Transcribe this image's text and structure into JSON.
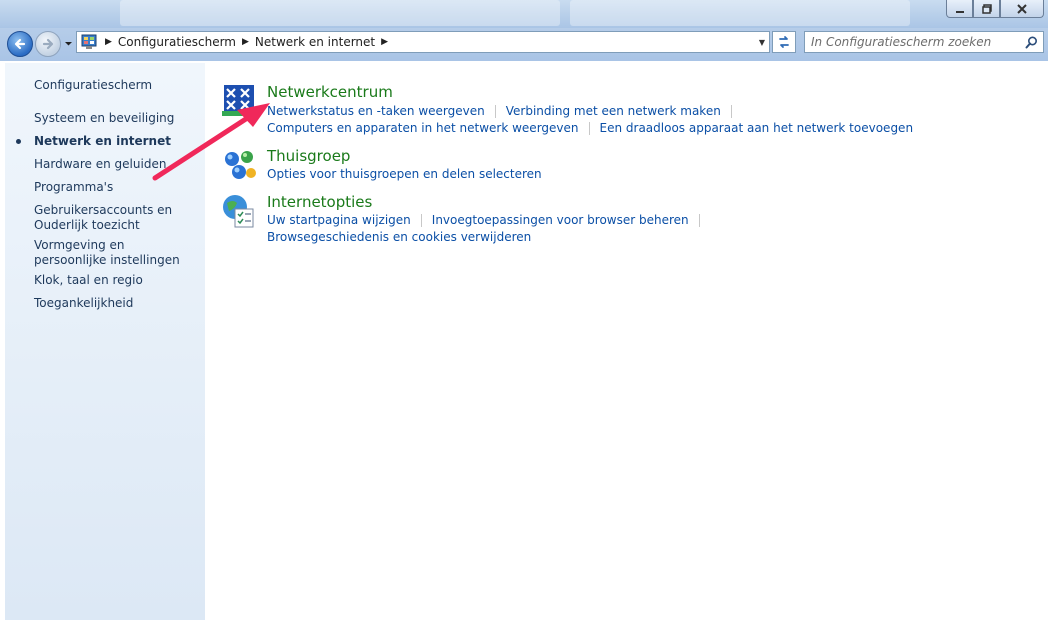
{
  "titlebar": {
    "minimize_icon": "minimize-icon",
    "maximize_icon": "maximize-icon",
    "close_icon": "close-icon"
  },
  "navbar": {
    "back_icon": "back-arrow-icon",
    "forward_icon": "forward-arrow-icon",
    "breadcrumbs": [
      "Configuratiescherm",
      "Netwerk en internet"
    ],
    "search_placeholder": "In Configuratiescherm zoeken"
  },
  "sidebar": {
    "items": [
      {
        "label": "Configuratiescherm"
      },
      {
        "label": "Systeem en beveiliging"
      },
      {
        "label": "Netwerk en internet",
        "active": true
      },
      {
        "label": "Hardware en geluiden"
      },
      {
        "label": "Programma's"
      },
      {
        "label": "Gebruikersaccounts en Ouderlijk toezicht"
      },
      {
        "label": "Vormgeving en persoonlijke instellingen"
      },
      {
        "label": "Klok, taal en regio"
      },
      {
        "label": "Toegankelijkheid"
      }
    ]
  },
  "main": {
    "categories": [
      {
        "title": "Netwerkcentrum",
        "icon": "network-center-icon",
        "links": [
          "Netwerkstatus en -taken weergeven",
          "Verbinding met een netwerk maken",
          "Computers en apparaten in het netwerk weergeven",
          "Een draadloos apparaat aan het netwerk toevoegen"
        ]
      },
      {
        "title": "Thuisgroep",
        "icon": "homegroup-icon",
        "links": [
          "Opties voor thuisgroepen en delen selecteren"
        ]
      },
      {
        "title": "Internetopties",
        "icon": "internet-options-icon",
        "links": [
          "Uw startpagina wijzigen",
          "Invoegtoepassingen voor browser beheren",
          "Browsegeschiedenis en cookies verwijderen"
        ]
      }
    ]
  },
  "annotation": {
    "color": "#f0285a"
  },
  "colors": {
    "link": "#0b4fa6",
    "category_title": "#1a7a1a",
    "sidebar_text": "#1e395b"
  }
}
